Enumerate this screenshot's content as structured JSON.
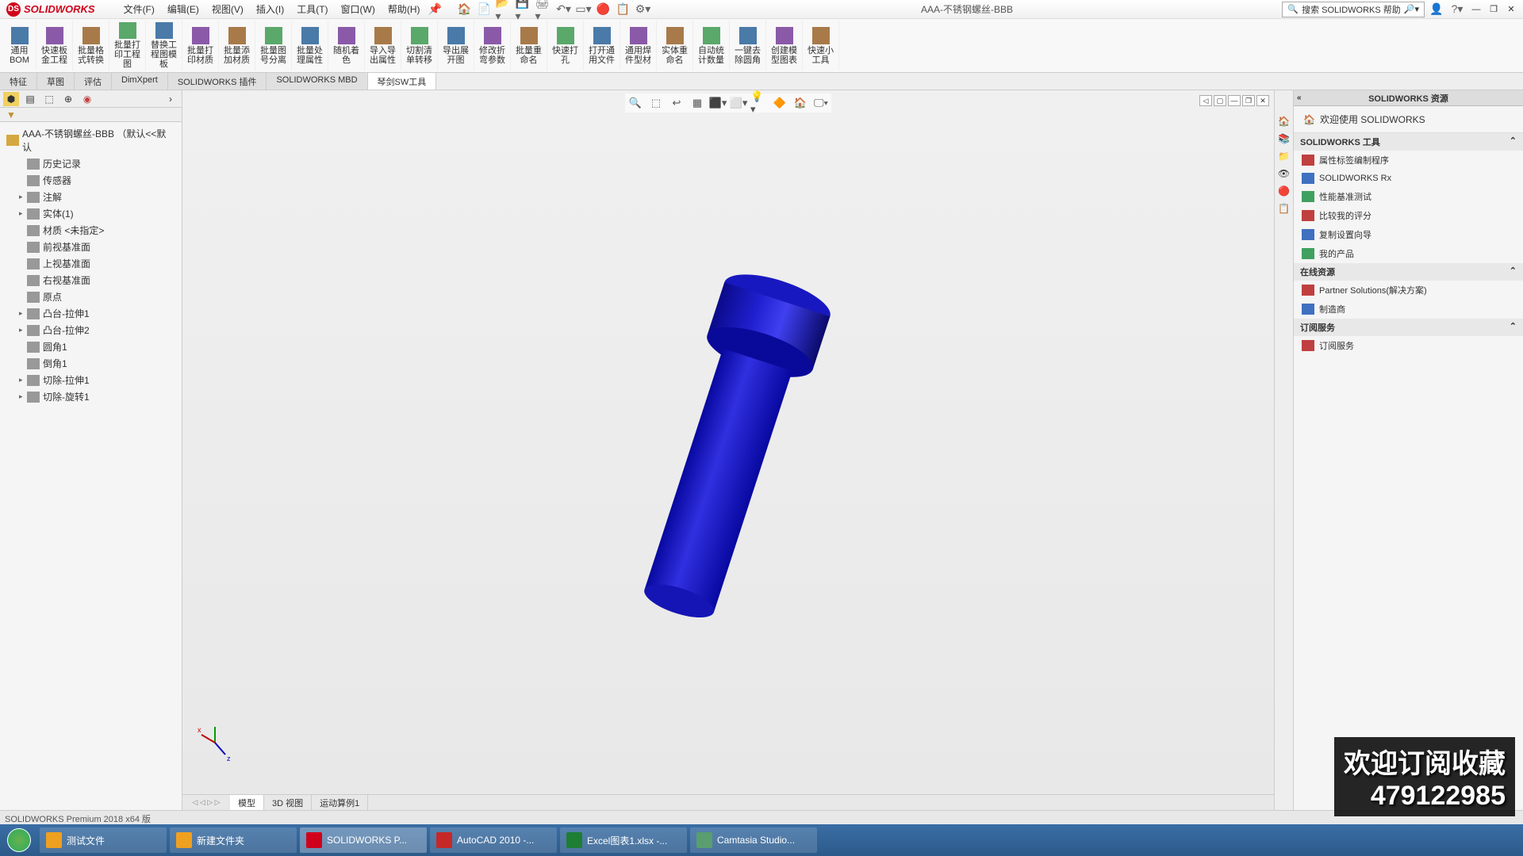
{
  "app": {
    "logo": "SOLIDWORKS",
    "title": "AAA-不锈钢螺丝-BBB"
  },
  "menu": [
    "文件(F)",
    "编辑(E)",
    "视图(V)",
    "插入(I)",
    "工具(T)",
    "窗口(W)",
    "帮助(H)"
  ],
  "search": {
    "placeholder": "搜索 SOLIDWORKS 帮助"
  },
  "ribbon": [
    "通用\nBOM",
    "快速板\n金工程",
    "批量格\n式转换",
    "批量打\n印工程\n图",
    "替换工\n程图模\n板",
    "批量打\n印材质",
    "批量添\n加材质",
    "批量图\n号分离",
    "批量处\n理属性",
    "随机着\n色",
    "导入导\n出属性",
    "切割清\n单转移",
    "导出展\n开图",
    "修改折\n弯参数",
    "批量重\n命名",
    "快速打\n孔",
    "打开通\n用文件",
    "通用焊\n件型材",
    "实体重\n命名",
    "自动统\n计数量",
    "一键去\n除圆角",
    "创建模\n型图表",
    "快速小\n工具"
  ],
  "tabs": [
    "特征",
    "草图",
    "评估",
    "DimXpert",
    "SOLIDWORKS 插件",
    "SOLIDWORKS MBD",
    "琴剑SW工具"
  ],
  "tree": {
    "root": "AAA-不锈钢螺丝-BBB （默认<<默认",
    "items": [
      {
        "t": "历史记录",
        "i": 1
      },
      {
        "t": "传感器",
        "i": 1
      },
      {
        "t": "注解",
        "i": 1,
        "e": 1
      },
      {
        "t": "实体(1)",
        "i": 1,
        "e": 1
      },
      {
        "t": "材质 <未指定>",
        "i": 1
      },
      {
        "t": "前视基准面",
        "i": 1
      },
      {
        "t": "上视基准面",
        "i": 1
      },
      {
        "t": "右视基准面",
        "i": 1
      },
      {
        "t": "原点",
        "i": 1
      },
      {
        "t": "凸台-拉伸1",
        "i": 1,
        "e": 1
      },
      {
        "t": "凸台-拉伸2",
        "i": 1,
        "e": 1
      },
      {
        "t": "圆角1",
        "i": 1
      },
      {
        "t": "倒角1",
        "i": 1
      },
      {
        "t": "切除-拉伸1",
        "i": 1,
        "e": 1
      },
      {
        "t": "切除-旋转1",
        "i": 1,
        "e": 1
      }
    ]
  },
  "viewtabs": [
    "模型",
    "3D 视图",
    "运动算例1"
  ],
  "rightpanel": {
    "title": "SOLIDWORKS 资源",
    "welcome": "欢迎使用  SOLIDWORKS",
    "g1": {
      "title": "SOLIDWORKS 工具",
      "items": [
        "属性标签编制程序",
        "SOLIDWORKS Rx",
        "性能基准测试",
        "比较我的评分",
        "复制设置向导",
        "我的产品"
      ]
    },
    "g2": {
      "title": "在线资源",
      "items": [
        "Partner Solutions(解决方案)",
        "制造商"
      ]
    },
    "g3": {
      "title": "订阅服务",
      "items": [
        "订阅服务"
      ]
    }
  },
  "status": "SOLIDWORKS Premium 2018 x64 版",
  "taskbar": [
    {
      "t": "测试文件",
      "c": "f"
    },
    {
      "t": "新建文件夹",
      "c": "f"
    },
    {
      "t": "SOLIDWORKS P...",
      "c": "sw",
      "a": 1
    },
    {
      "t": "AutoCAD 2010 -...",
      "c": "ac"
    },
    {
      "t": "Excel图表1.xlsx -...",
      "c": "xl"
    },
    {
      "t": "Camtasia Studio...",
      "c": "cm"
    }
  ],
  "overlay": {
    "l1": "欢迎订阅收藏",
    "l2": "479122985"
  }
}
